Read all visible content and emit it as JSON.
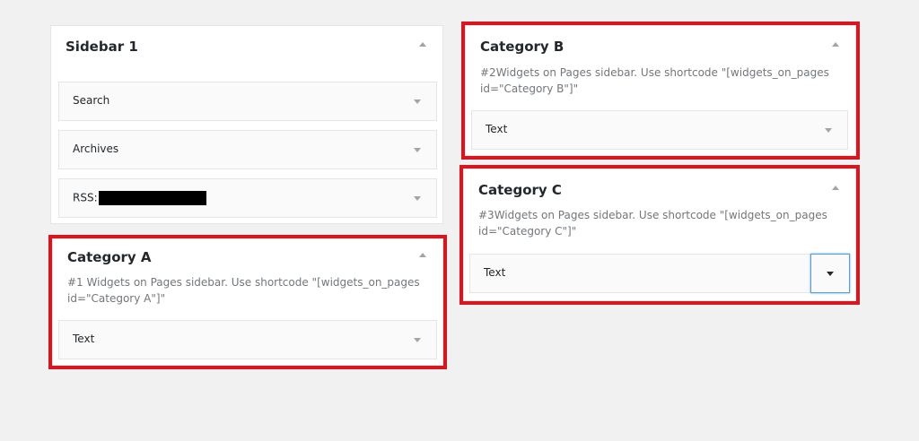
{
  "sidebar1": {
    "title": "Sidebar 1",
    "widgets": [
      {
        "label": "Search"
      },
      {
        "label": "Archives"
      },
      {
        "label": "RSS:"
      }
    ]
  },
  "category_a": {
    "title": "Category A",
    "description": "#1 Widgets on Pages sidebar. Use shortcode \"[widgets_on_pages id=\"Category A\"]\"",
    "widget_label": "Text"
  },
  "category_b": {
    "title": "Category B",
    "description": "#2Widgets on Pages sidebar. Use shortcode \"[widgets_on_pages id=\"Category B\"]\"",
    "widget_label": "Text"
  },
  "category_c": {
    "title": "Category C",
    "description": "#3Widgets on Pages sidebar. Use shortcode \"[widgets_on_pages id=\"Category C\"]\"",
    "widget_label": "Text"
  },
  "colors": {
    "highlight": "#d9161d",
    "focus": "#5b9dd9"
  }
}
